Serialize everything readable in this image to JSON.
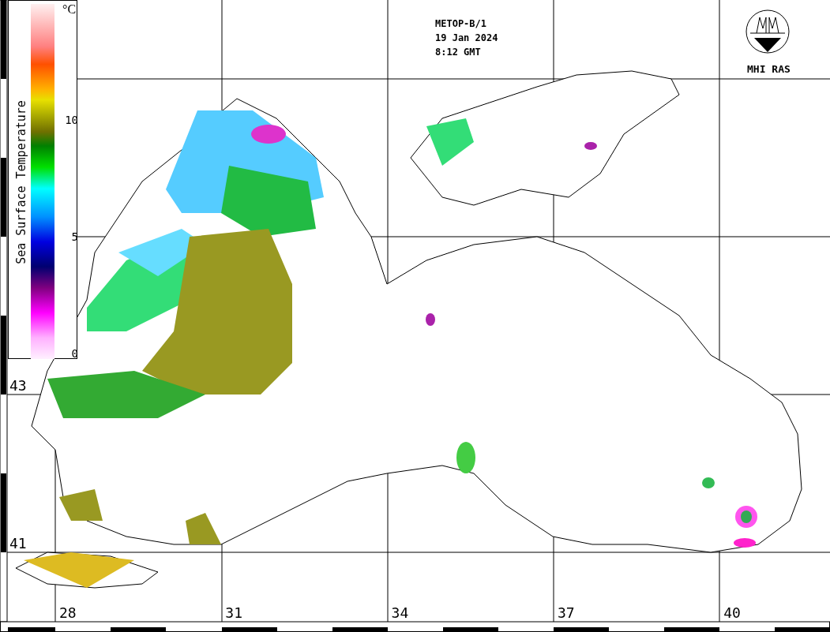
{
  "header": {
    "satellite": "METOP-B/1",
    "date": "19 Jan 2024",
    "time": "8:12 GMT",
    "organization": "MHI RAS"
  },
  "legend": {
    "title": "Sea Surface Temperature",
    "unit": "°C",
    "ticks": [
      "10",
      "5",
      "0"
    ]
  },
  "map": {
    "latitude_labels": [
      "43",
      "41"
    ],
    "longitude_labels": [
      "28",
      "31",
      "34",
      "37",
      "40"
    ]
  }
}
